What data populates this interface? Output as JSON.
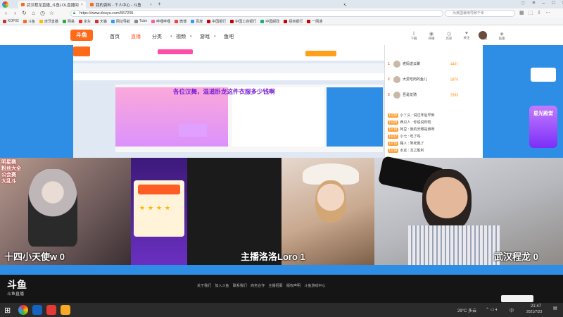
{
  "browser": {
    "tabs": [
      {
        "label": "武汉程龙直播_斗鱼LOL直播间",
        "active": true
      },
      {
        "label": "我的资料 - 个人中心 - 斗鱼",
        "active": false
      }
    ],
    "url": "https://www.douyu.com/557205",
    "search_placeholder": "为美国暴雨导致千年",
    "bookmarks": [
      "KOF02",
      "斗鱼",
      "虎牙直播",
      "网易",
      "京东",
      "天猫",
      "网址导航",
      "Tubo",
      "哔哩哔哩",
      "微博",
      "百度",
      "中国银行",
      "中国工商银行",
      "中国邮政",
      "招商银行",
      "一网通"
    ]
  },
  "site": {
    "logo": "斗鱼",
    "nav": [
      "首页",
      "直播",
      "分类",
      "视频",
      "游戏",
      "鱼吧"
    ],
    "nav_active": "直播",
    "header_icons": [
      {
        "label": "下载",
        "icon": "download-icon"
      },
      {
        "label": "开播",
        "icon": "broadcast-icon"
      },
      {
        "label": "历史",
        "icon": "history-icon"
      },
      {
        "label": "关注",
        "icon": "follow-icon"
      },
      {
        "label": "消息",
        "icon": "message-icon"
      },
      {
        "label": "鱼翅",
        "icon": "wallet-icon"
      }
    ]
  },
  "stream": {
    "screen_title": "各位汉舞，温道卧龙这件衣服多少钱啊",
    "ranking": [
      {
        "rank": "1",
        "name": "老妈送云聚",
        "score": "4401"
      },
      {
        "rank": "2",
        "name": "大爱吃肉的鱼儿",
        "score": "2870"
      },
      {
        "rank": "3",
        "name": "吾是龙骑",
        "score": "2933"
      }
    ],
    "chat": [
      {
        "level": "LV20",
        "text": "小丫头 : 说过年后早到"
      },
      {
        "level": "LV23",
        "text": "西瓜人 : 你说说你吧"
      },
      {
        "level": "LV19",
        "text": "阿豆 : 我的天哪是谁呀"
      },
      {
        "level": "LV17",
        "text": "小七 : 吃了吗"
      },
      {
        "level": "LV15",
        "text": "路人 : 笑死我了"
      },
      {
        "level": "LV14",
        "text": "水友 : 龙之胜利"
      }
    ],
    "promo_label": "星光殿堂",
    "side_text": [
      "明星赛",
      "粉丝大全",
      "公会赛",
      "大乱斗"
    ],
    "cams": [
      {
        "label": "十四小天使w  0"
      },
      {
        "label": "主播洛洛Loro  1"
      },
      {
        "label": "武汉程龙  0"
      }
    ]
  },
  "footer": {
    "logo": "斗鱼",
    "sub": "斗鱼直播",
    "links": "关于我们 加入斗鱼 联系我们 商务合作 主播招募 版权声明 斗鱼游戏中心"
  },
  "taskbar": {
    "weather": "29°C 多云",
    "ime": "中",
    "time": "21:47",
    "date": "2021/7/23"
  },
  "colors": {
    "brand": "#ff5d23",
    "stream_bg": "#2e8ee6",
    "tab_bar": "#dfe6ee"
  }
}
